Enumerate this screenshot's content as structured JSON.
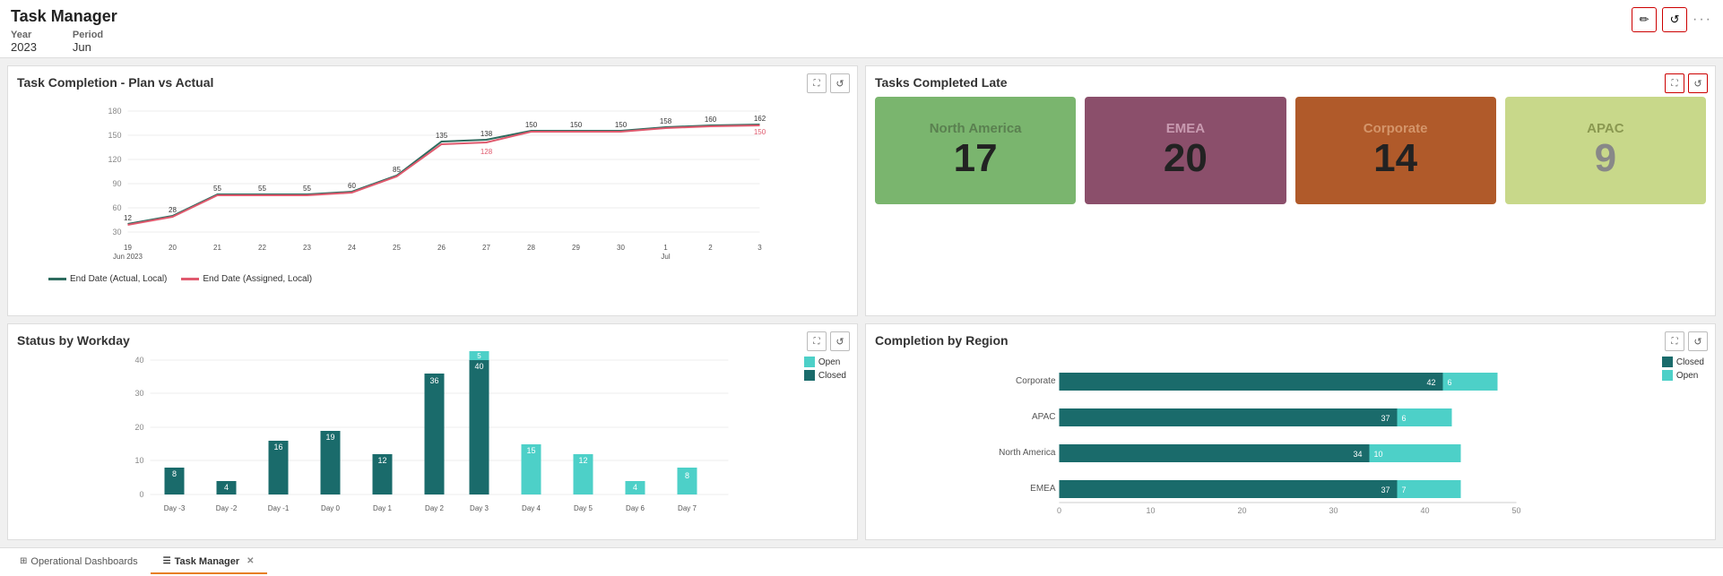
{
  "header": {
    "title": "Task Manager",
    "filters": [
      {
        "label": "Year",
        "value": "2023"
      },
      {
        "label": "Period",
        "value": "Jun"
      }
    ],
    "actions": {
      "edit_label": "Edit Dashboard icon",
      "refresh_label": "Refresh Dashboard",
      "edit_icon": "✏",
      "refresh_icon": "↺",
      "more_icon": "···"
    }
  },
  "panels": {
    "line_chart": {
      "title": "Task Completion - Plan vs Actual",
      "legend": [
        {
          "label": "End Date (Actual, Local)",
          "color": "#2d6b5e"
        },
        {
          "label": "End Date (Assigned, Local)",
          "color": "#e05a6e"
        }
      ],
      "x_labels": [
        "19\nJun 2023",
        "20",
        "21",
        "22",
        "23",
        "24",
        "25",
        "26",
        "27",
        "28",
        "29",
        "30",
        "1\nJul",
        "2",
        "3"
      ],
      "y_labels": [
        "30",
        "60",
        "90",
        "120",
        "150",
        "180"
      ],
      "data_labels": [
        "12",
        "28",
        "55",
        "55",
        "55",
        "60",
        "85",
        "135",
        "138",
        "150",
        "150",
        "150",
        "158",
        "160",
        "162"
      ],
      "data_labels2": [
        "",
        "",
        "",
        "",
        "",
        "",
        "",
        "",
        "128",
        "",
        "",
        "",
        "",
        "",
        "150"
      ]
    },
    "tasks_late": {
      "title": "Tasks Completed Late",
      "cards": [
        {
          "region": "North America",
          "value": "17",
          "bg": "#7ab56e",
          "text_color": "#5a8550"
        },
        {
          "region": "EMEA",
          "value": "20",
          "bg": "#8b4f6b",
          "text_color": "#6b3050"
        },
        {
          "region": "Corporate",
          "value": "14",
          "bg": "#b05a2a",
          "text_color": "#884020"
        },
        {
          "region": "APAC",
          "value": "9",
          "bg": "#c8d88a",
          "text_color": "#8a9850"
        }
      ]
    },
    "workday": {
      "title": "Status by Workday",
      "legend": {
        "open_label": "Open",
        "closed_label": "Closed",
        "open_color": "#4dd0c8",
        "closed_color": "#1a6b6b"
      },
      "bars": [
        {
          "day": "Day -3",
          "open": 0,
          "closed": 8
        },
        {
          "day": "Day -2",
          "open": 0,
          "closed": 4
        },
        {
          "day": "Day -1",
          "open": 0,
          "closed": 16
        },
        {
          "day": "Day 0",
          "open": 0,
          "closed": 19
        },
        {
          "day": "Day 1",
          "open": 0,
          "closed": 12
        },
        {
          "day": "Day 2",
          "open": 0,
          "closed": 36
        },
        {
          "day": "Day 3",
          "open": 5,
          "closed": 40
        },
        {
          "day": "Day 4",
          "open": 15,
          "closed": 0
        },
        {
          "day": "Day 5",
          "open": 12,
          "closed": 0
        },
        {
          "day": "Day 6",
          "open": 4,
          "closed": 0
        },
        {
          "day": "Day 7",
          "open": 8,
          "closed": 0
        }
      ],
      "y_labels": [
        "0",
        "10",
        "20",
        "30",
        "40"
      ]
    },
    "region": {
      "title": "Completion by Region",
      "legend": {
        "closed_label": "Closed",
        "open_label": "Open",
        "closed_color": "#1a6b6b",
        "open_color": "#4dd0c8"
      },
      "rows": [
        {
          "name": "Corporate",
          "closed": 42,
          "open": 6
        },
        {
          "name": "APAC",
          "closed": 37,
          "open": 6
        },
        {
          "name": "North America",
          "closed": 34,
          "open": 10
        },
        {
          "name": "EMEA",
          "closed": 37,
          "open": 7
        }
      ],
      "x_labels": [
        "0",
        "10",
        "20",
        "30",
        "40",
        "50"
      ],
      "max": 50
    }
  },
  "tabs": [
    {
      "label": "Operational Dashboards",
      "active": false,
      "closable": false
    },
    {
      "label": "Task Manager",
      "active": true,
      "closable": true
    }
  ]
}
